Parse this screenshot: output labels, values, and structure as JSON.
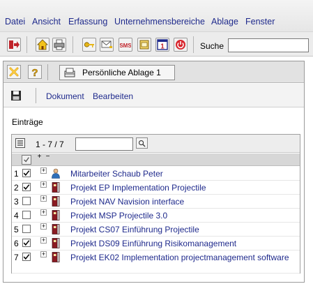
{
  "menu": [
    "Datei",
    "Ansicht",
    "Erfassung",
    "Unternehmensbereiche",
    "Ablage",
    "Fenster"
  ],
  "toolbar": {
    "buttons": [
      {
        "name": "exit-icon"
      },
      {
        "name": "home-icon"
      },
      {
        "name": "print-icon"
      },
      {
        "name": "key-icon"
      },
      {
        "name": "mail-icon"
      },
      {
        "name": "sms-icon",
        "text": "SMS"
      },
      {
        "name": "archive-icon"
      },
      {
        "name": "calendar-icon",
        "text": "1"
      },
      {
        "name": "stop-icon"
      }
    ],
    "search_label": "Suche",
    "search_value": ""
  },
  "panel": {
    "tab_label": "Persönliche Ablage 1",
    "actions": [
      "Dokument",
      "Bearbeiten"
    ],
    "section_title": "Einträge",
    "range": "1 - 7 / 7",
    "filter_value": "",
    "col_plus": "+",
    "col_minus": "−",
    "rows": [
      {
        "num": "1",
        "checked": true,
        "icon": "person-icon",
        "label": "Mitarbeiter Schaub Peter"
      },
      {
        "num": "2",
        "checked": true,
        "icon": "project-icon",
        "label": "Projekt EP Implementation Projectile"
      },
      {
        "num": "3",
        "checked": false,
        "icon": "project-icon",
        "label": "Projekt NAV Navision interface"
      },
      {
        "num": "4",
        "checked": false,
        "icon": "project-icon",
        "label": "Projekt MSP Projectile 3.0"
      },
      {
        "num": "5",
        "checked": false,
        "icon": "project-icon",
        "label": "Projekt CS07 Einführung Projectile"
      },
      {
        "num": "6",
        "checked": true,
        "icon": "project-icon",
        "label": "Projekt DS09 Einführung Risikomanagement"
      },
      {
        "num": "7",
        "checked": true,
        "icon": "project-icon",
        "label": "Projekt EK02 Implementation projectmanagement software"
      }
    ]
  },
  "colors": {
    "link": "#1f2a8c",
    "project": "#8b1a22",
    "person": "#2f6fb8"
  }
}
